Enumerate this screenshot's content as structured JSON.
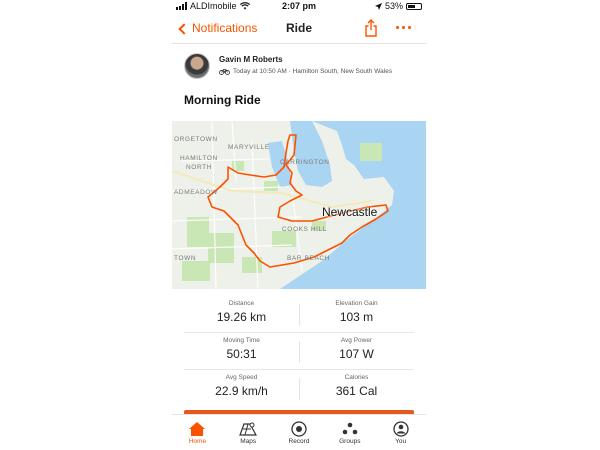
{
  "status_bar": {
    "carrier": "ALDImobile",
    "time": "2:07 pm",
    "battery": "53%"
  },
  "nav": {
    "back_label": "Notifications",
    "title": "Ride",
    "share_icon": "share-icon",
    "more_icon": "more-icon"
  },
  "athlete": {
    "name": "Gavin M Roberts",
    "meta": "Today at 10:50 AM · Hamilton South, New South Wales",
    "activity_icon": "bike-icon"
  },
  "activity": {
    "title": "Morning Ride"
  },
  "map": {
    "labels": {
      "georgetown": "ORGETOWN",
      "maryville": "MARYVILLE",
      "carrington": "CARRINGTON",
      "hamilton_north": "HAMILTON",
      "hamilton_north_2": "NORTH",
      "broadmeadow": "ADMEADOW",
      "cooks_hill": "COOKS HILL",
      "bar_beach": "BAR BEACH",
      "town": "TOWN",
      "city": "Newcastle"
    },
    "route_color": "#fc5200",
    "water_color": "#a9d4f2"
  },
  "stats": [
    {
      "left_label": "Distance",
      "left_value": "19.26 km",
      "right_label": "Elevation Gain",
      "right_value": "103 m"
    },
    {
      "left_label": "Moving Time",
      "left_value": "50:31",
      "right_label": "Avg Power",
      "right_value": "107 W"
    },
    {
      "left_label": "Avg Speed",
      "left_value": "22.9 km/h",
      "right_label": "Calories",
      "right_value": "361 Cal"
    }
  ],
  "tabs": [
    {
      "label": "Home",
      "icon": "home-icon",
      "active": true
    },
    {
      "label": "Maps",
      "icon": "maps-icon",
      "active": false
    },
    {
      "label": "Record",
      "icon": "record-icon",
      "active": false
    },
    {
      "label": "Groups",
      "icon": "groups-icon",
      "active": false
    },
    {
      "label": "You",
      "icon": "you-icon",
      "active": false
    }
  ],
  "colors": {
    "accent": "#fc5200",
    "text": "#222222"
  }
}
